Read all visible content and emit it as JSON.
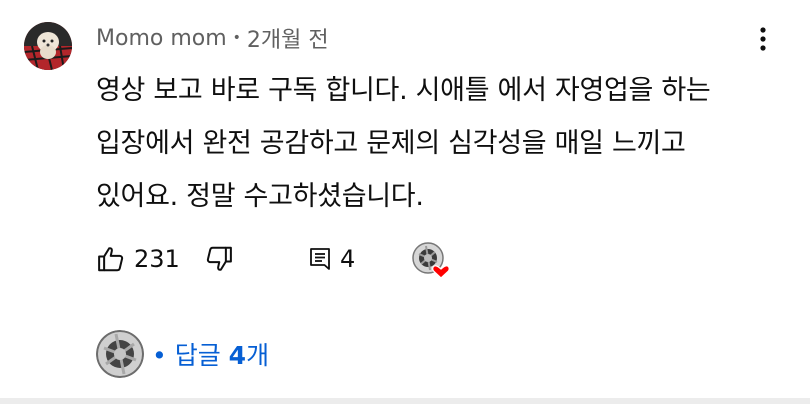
{
  "comment": {
    "author": "Momo mom",
    "separator": "•",
    "time": "2개월 전",
    "text": "영상 보고 바로 구독 합니다. 시애틀 에서 자영업을 하는\n입장에서 완전 공감하고 문제의 심각성을 매일 느끼고\n있어요. 정말 수고하셨습니다.",
    "menu_icon": "more-vert-icon"
  },
  "actions": {
    "like_icon": "thumb-up-icon",
    "like_count": "231",
    "dislike_icon": "thumb-down-icon",
    "reply_icon": "comment-reply-icon",
    "reply_count": "4",
    "creator_heart_icon": "creator-heart-icon",
    "heart_color": "#ff0000"
  },
  "replies": {
    "prefix": "•",
    "label_pre": "답글 ",
    "count": "4",
    "label_post": "개",
    "color": "#065fd4"
  }
}
